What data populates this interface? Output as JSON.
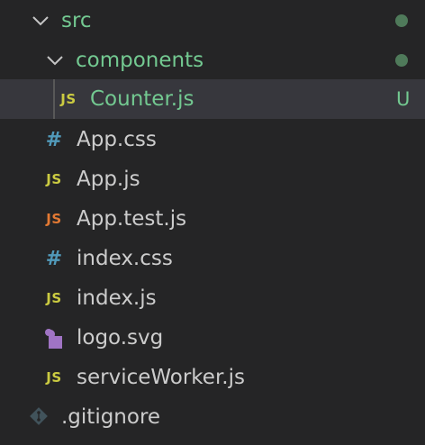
{
  "explorer": {
    "folders": {
      "src": {
        "label": "src",
        "expanded": true,
        "status_dot": true
      },
      "components": {
        "label": "components",
        "expanded": true,
        "status_dot": true
      }
    },
    "files": [
      {
        "label": "Counter.js",
        "icon": "js-icon",
        "icon_text": "JS",
        "status": "U",
        "selected": true
      },
      {
        "label": "App.css",
        "icon": "css-icon",
        "icon_text": "#"
      },
      {
        "label": "App.js",
        "icon": "js-icon",
        "icon_text": "JS"
      },
      {
        "label": "App.test.js",
        "icon": "test-js-icon",
        "icon_text": "JS"
      },
      {
        "label": "index.css",
        "icon": "css-icon",
        "icon_text": "#"
      },
      {
        "label": "index.js",
        "icon": "js-icon",
        "icon_text": "JS"
      },
      {
        "label": "logo.svg",
        "icon": "svg-icon"
      },
      {
        "label": "serviceWorker.js",
        "icon": "js-icon",
        "icon_text": "JS"
      },
      {
        "label": ".gitignore",
        "icon": "git-icon"
      }
    ]
  },
  "colors": {
    "background": "#252526",
    "selected_row": "#37373d",
    "untracked_green": "#73c991",
    "text": "#cccccc",
    "js_yellow": "#cbcb41",
    "test_orange": "#e37933",
    "css_blue": "#519aba",
    "svg_purple": "#a074c4",
    "git_gray": "#41535b"
  }
}
